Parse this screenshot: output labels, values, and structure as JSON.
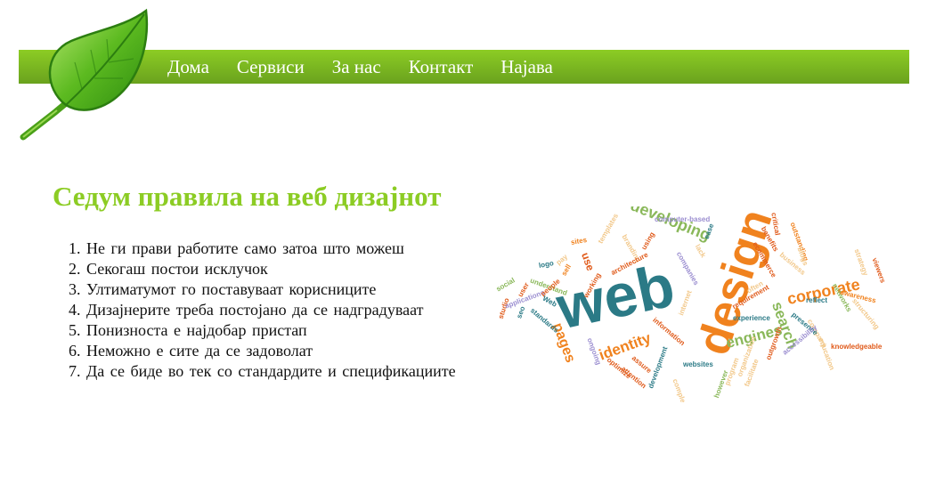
{
  "nav": {
    "items": [
      "Дома",
      "Сервиси",
      "За нас",
      "Контакт",
      "Најава"
    ]
  },
  "colors": {
    "accent": "#8ccc24",
    "nav_bg_top": "#8ccc24",
    "nav_bg_bottom": "#6aa21e",
    "leaf": "#3fa41a"
  },
  "main": {
    "title": "Седум правила на веб дизајнот",
    "rules": [
      "Не ги прави работите само затоа што можеш",
      "Секогаш постои исклучок",
      "Ултиматумот го поставуваат корисниците",
      "Дизајнерите треба постојано да се надградуваат",
      "Понизноста е најдобар пристап",
      "Неможно е сите да се задоволат",
      "Да се биде во тек со стандардите и спецификациите"
    ]
  },
  "word_cloud": {
    "words": [
      "web",
      "design",
      "developing",
      "corporate",
      "identity",
      "pages",
      "engines",
      "search",
      "computer-based",
      "studio",
      "social",
      "user",
      "applications",
      "seo",
      "standards",
      "logo",
      "understand",
      "people",
      "use",
      "sites",
      "Web",
      "working",
      "templates",
      "branding",
      "architecture",
      "using",
      "companies",
      "lack",
      "ease",
      "critical",
      "benefits",
      "ecommerce",
      "business",
      "outstanding",
      "blogs",
      "strategy",
      "viewers",
      "networks",
      "awareness",
      "structuring",
      "knowledgeable",
      "education",
      "company",
      "presence",
      "reflect",
      "accessibility",
      "experience",
      "requirement",
      "often",
      "outgrowth",
      "facilitate",
      "organization",
      "program",
      "however",
      "websites",
      "development",
      "attention",
      "assure",
      "optimize",
      "ongoing",
      "information",
      "internet",
      "pay",
      "sell",
      "complete"
    ]
  }
}
